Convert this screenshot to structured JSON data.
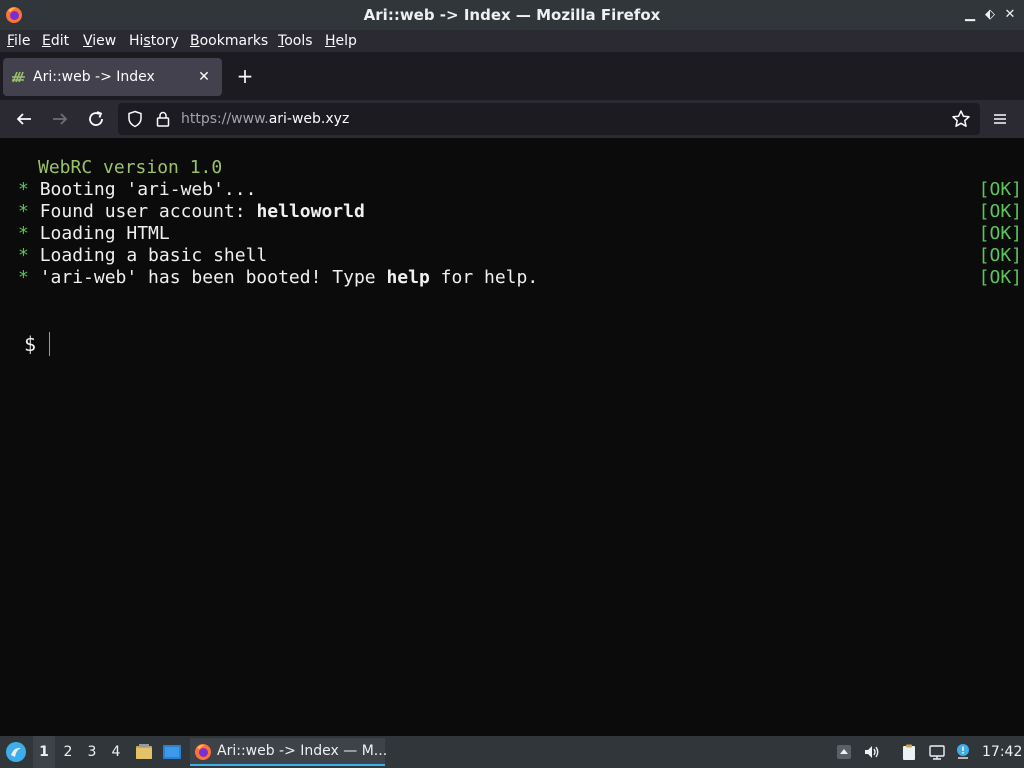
{
  "window": {
    "title": "Ari::web -> Index — Mozilla Firefox",
    "minimize_icon": "minimize-icon",
    "restore_icon": "restore-icon",
    "close_icon": "close-icon"
  },
  "menu": {
    "items": [
      {
        "first": "F",
        "rest": "ile"
      },
      {
        "first": "E",
        "rest": "dit"
      },
      {
        "first": "V",
        "rest": "iew"
      },
      {
        "pre": "Hi",
        "first": "s",
        "rest": "tory"
      },
      {
        "first": "B",
        "rest": "ookmarks"
      },
      {
        "first": "T",
        "rest": "ools"
      },
      {
        "first": "H",
        "rest": "elp"
      }
    ]
  },
  "tabs": [
    {
      "label": "Ari::web -> Index",
      "close": "✕"
    }
  ],
  "newtab_label": "+",
  "urlbar": {
    "prefix": "https://www.",
    "domain": "ari-web.xyz"
  },
  "terminal": {
    "header": "WebRC version 1.0",
    "bullet": "*",
    "lines": [
      {
        "pre": "Booting 'ari-web'...",
        "bold": "",
        "post": "",
        "status": "[OK]"
      },
      {
        "pre": "Found user account: ",
        "bold": "helloworld",
        "post": "",
        "status": "[OK]"
      },
      {
        "pre": "Loading HTML",
        "bold": "",
        "post": "",
        "status": "[OK]"
      },
      {
        "pre": "Loading a basic shell",
        "bold": "",
        "post": "",
        "status": "[OK]"
      },
      {
        "pre": "'ari-web' has been booted! Type ",
        "bold": "help",
        "post": " for help.",
        "status": "[OK]"
      }
    ],
    "prompt": "$"
  },
  "taskbar": {
    "workspaces": [
      "1",
      "2",
      "3",
      "4"
    ],
    "active_workspace": "1",
    "task_title": "Ari::web -> Index — M...",
    "clock": "17:42"
  },
  "colors": {
    "terminal_green": "#5ec45e",
    "header_olive": "#9bc26b",
    "accent": "#3daee9"
  }
}
